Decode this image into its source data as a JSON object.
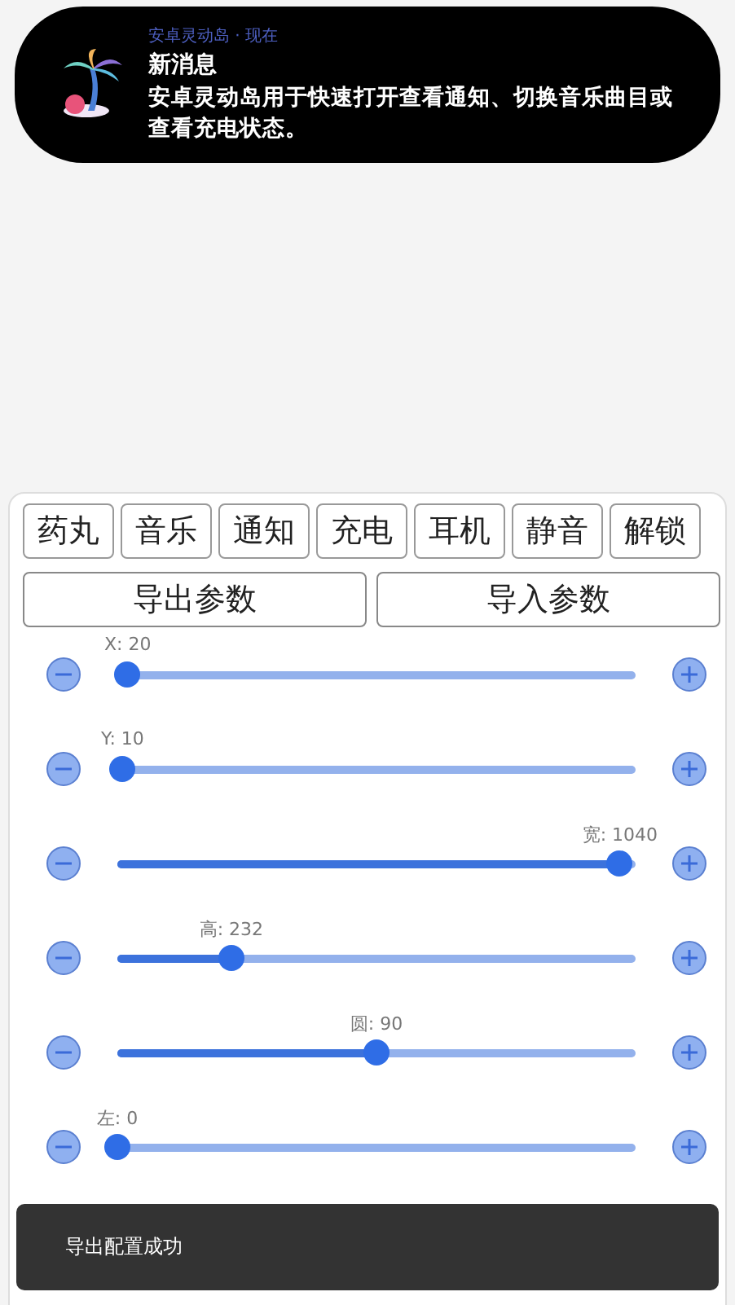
{
  "notification": {
    "app": "安卓灵动岛 · 现在",
    "title": "新消息",
    "body": "安卓灵动岛用于快速打开查看通知、切换音乐曲目或查看充电状态。"
  },
  "tabs": [
    {
      "label": "药丸"
    },
    {
      "label": "音乐"
    },
    {
      "label": "通知"
    },
    {
      "label": "充电"
    },
    {
      "label": "耳机"
    },
    {
      "label": "静音"
    },
    {
      "label": "解锁"
    }
  ],
  "buttons": [
    "导出参数",
    "导入参数"
  ],
  "sliders": [
    {
      "label": "X: 20",
      "level": 0.02
    },
    {
      "label": "Y: 10",
      "level": 0.01
    },
    {
      "label": "宽: 1040",
      "level": 0.97
    },
    {
      "label": "高: 232",
      "level": 0.22
    },
    {
      "label": "圆: 90",
      "level": 0.5
    },
    {
      "label": "左: 0",
      "level": 0
    }
  ],
  "toast": "导出配置成功"
}
